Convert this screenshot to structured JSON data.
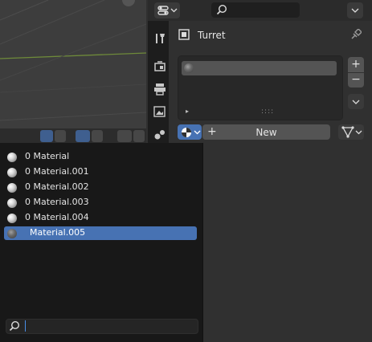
{
  "properties": {
    "object_name": "Turret",
    "material_slots": {
      "new_button_label": "New",
      "add_symbol": "+",
      "remove_symbol": "−",
      "expand_symbol": "▸",
      "grip_symbol": "::::"
    }
  },
  "tabs": [
    {
      "name": "tool",
      "icon": "wrench-screwdriver-icon"
    },
    {
      "name": "render",
      "icon": "render-icon"
    },
    {
      "name": "output",
      "icon": "printer-icon"
    },
    {
      "name": "view-layer",
      "icon": "image-icon"
    },
    {
      "name": "scene",
      "icon": "scene-icon"
    }
  ],
  "material_browser": {
    "items": [
      {
        "label": "0 Material",
        "selected": false
      },
      {
        "label": "0 Material.001",
        "selected": false
      },
      {
        "label": "0 Material.002",
        "selected": false
      },
      {
        "label": "0 Material.003",
        "selected": false
      },
      {
        "label": "0 Material.004",
        "selected": false
      },
      {
        "label": "Material.005",
        "selected": true
      }
    ],
    "search_value": ""
  },
  "colors": {
    "accent": "#4772b3",
    "panel_bg": "#303030",
    "popup_bg": "#181818",
    "viewport_bg": "#3d3d3d"
  }
}
